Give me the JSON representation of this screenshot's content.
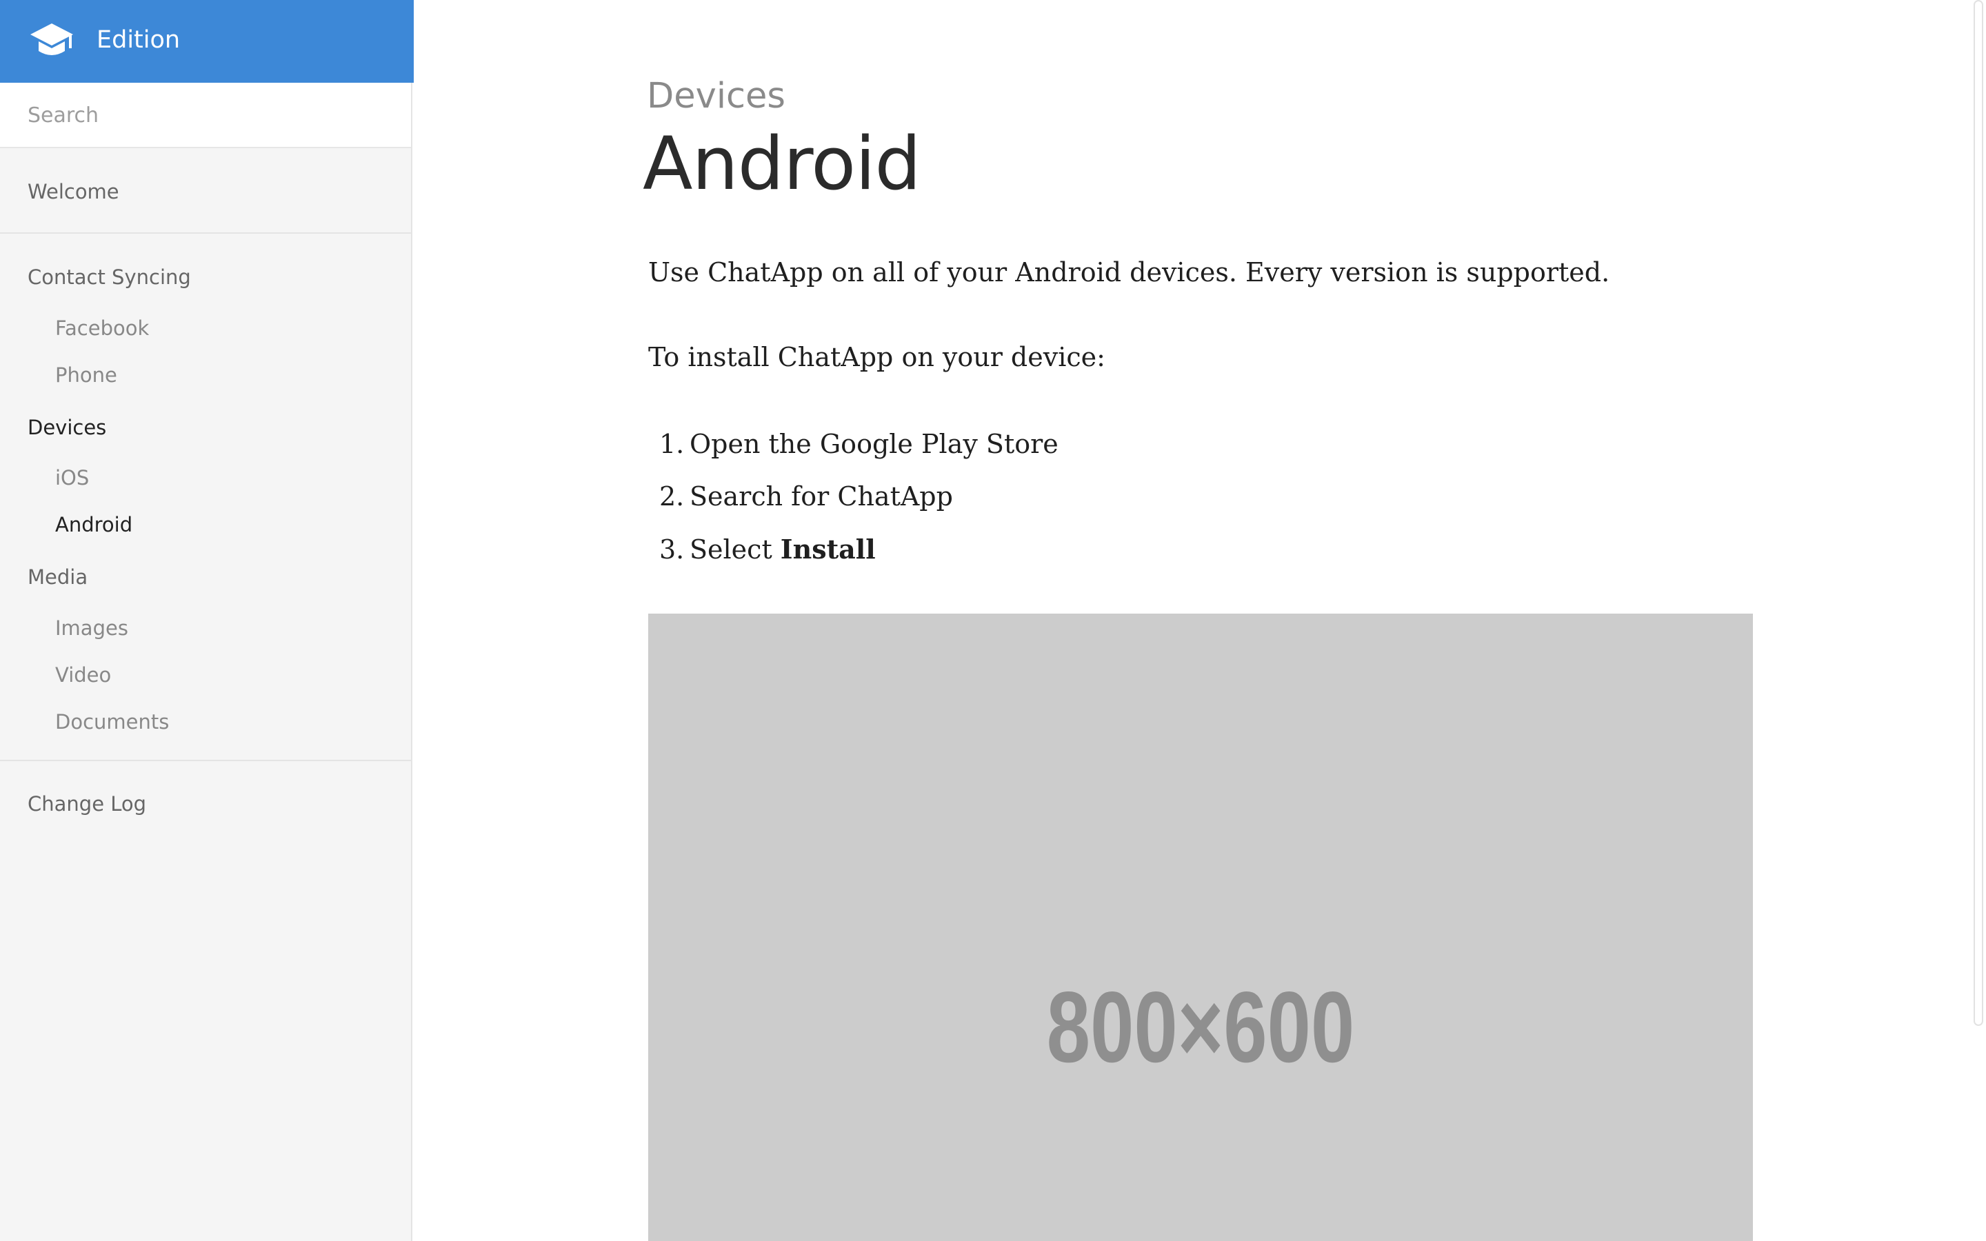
{
  "app": {
    "name": "Edition",
    "brand_color": "#3d88d7",
    "logo_icon": "graduation-cap-icon"
  },
  "search": {
    "placeholder": "Search",
    "value": ""
  },
  "sidebar": {
    "welcome": "Welcome",
    "contact_syncing": "Contact Syncing",
    "contact_syncing_items": [
      "Facebook",
      "Phone"
    ],
    "devices": "Devices",
    "devices_items": [
      "iOS",
      "Android"
    ],
    "media": "Media",
    "media_items": [
      "Images",
      "Video",
      "Documents"
    ],
    "change_log": "Change Log",
    "active_item": "Android"
  },
  "main": {
    "breadcrumb": "Devices",
    "title": "Android",
    "intro": "Use ChatApp on all of your Android devices. Every version is supported.",
    "install_intro": "To install ChatApp on your device:",
    "steps": [
      {
        "num": "1.",
        "text": "Open the Google Play Store"
      },
      {
        "num": "2.",
        "text": "Search for ChatApp"
      },
      {
        "num": "3.",
        "text": "Select ",
        "bold": "Install"
      }
    ],
    "image_placeholder": "800×600"
  }
}
